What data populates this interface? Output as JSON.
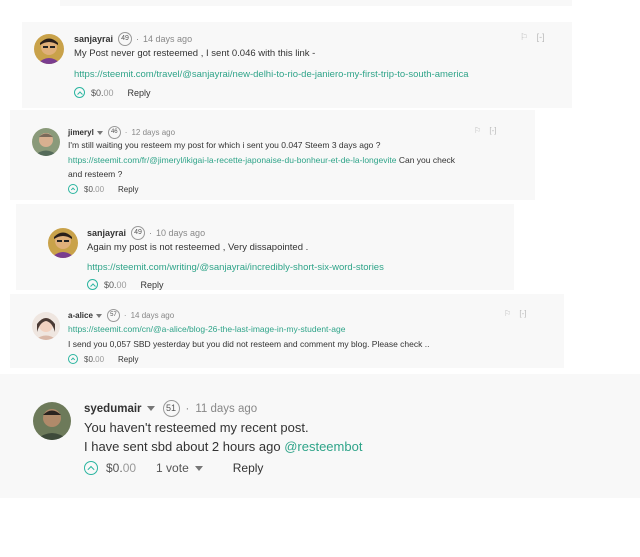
{
  "comments": [
    {
      "author": "sanjayrai",
      "reputation": "49",
      "time": "14 days ago",
      "body_line1": "My Post never got resteemed , I sent 0.046 with this link -",
      "link": "https://steemit.com/travel/@sanjayrai/new-delhi-to-rio-de-janiero-my-first-trip-to-south-america",
      "payout": "$0.",
      "payout_cents": "00",
      "reply_label": "Reply",
      "flag_icon": "flag-icon",
      "collapse_label": "[-]"
    },
    {
      "author": "jimeryl",
      "reputation": "46",
      "time": "12 days ago",
      "body_line1": "I'm still waiting you resteem my post for which i sent you 0.047 Steem 3 days ago ?",
      "link": "https://steemit.com/fr/@jimeryl/ikigai-la-recette-japonaise-du-bonheur-et-de-la-longevite",
      "body_after_link": " Can you check",
      "body_line3": "and resteem ?",
      "payout": "$0.",
      "payout_cents": "00",
      "reply_label": "Reply",
      "collapse_label": "[-]"
    },
    {
      "author": "sanjayrai",
      "reputation": "49",
      "time": "10 days ago",
      "body_line1": "Again my post is not resteemed , Very dissapointed .",
      "link": "https://steemit.com/writing/@sanjayrai/incredibly-short-six-word-stories",
      "payout": "$0.",
      "payout_cents": "00",
      "reply_label": "Reply"
    },
    {
      "author": "a-alice",
      "reputation": "57",
      "time": "14 days ago",
      "link": "https://steemit.com/cn/@a-alice/blog-26-the-last-image-in-my-student-age",
      "body_line2": "I send you 0,057 SBD yesterday but you did not resteem and comment my blog. Please check ..",
      "payout": "$0.",
      "payout_cents": "00",
      "reply_label": "Reply",
      "collapse_label": "[-]"
    },
    {
      "author": "syedumair",
      "reputation": "51",
      "time": "11 days ago",
      "body_line1": "You haven't resteemed my recent post.",
      "body_line2_text": "I have sent sbd about 2 hours ago ",
      "mention": "@resteembot",
      "payout": "$0.",
      "payout_cents": "00",
      "votes_label": "1 vote",
      "reply_label": "Reply"
    }
  ],
  "top_partial": {
    "payout": "$0.00",
    "reply_label": "Reply"
  }
}
